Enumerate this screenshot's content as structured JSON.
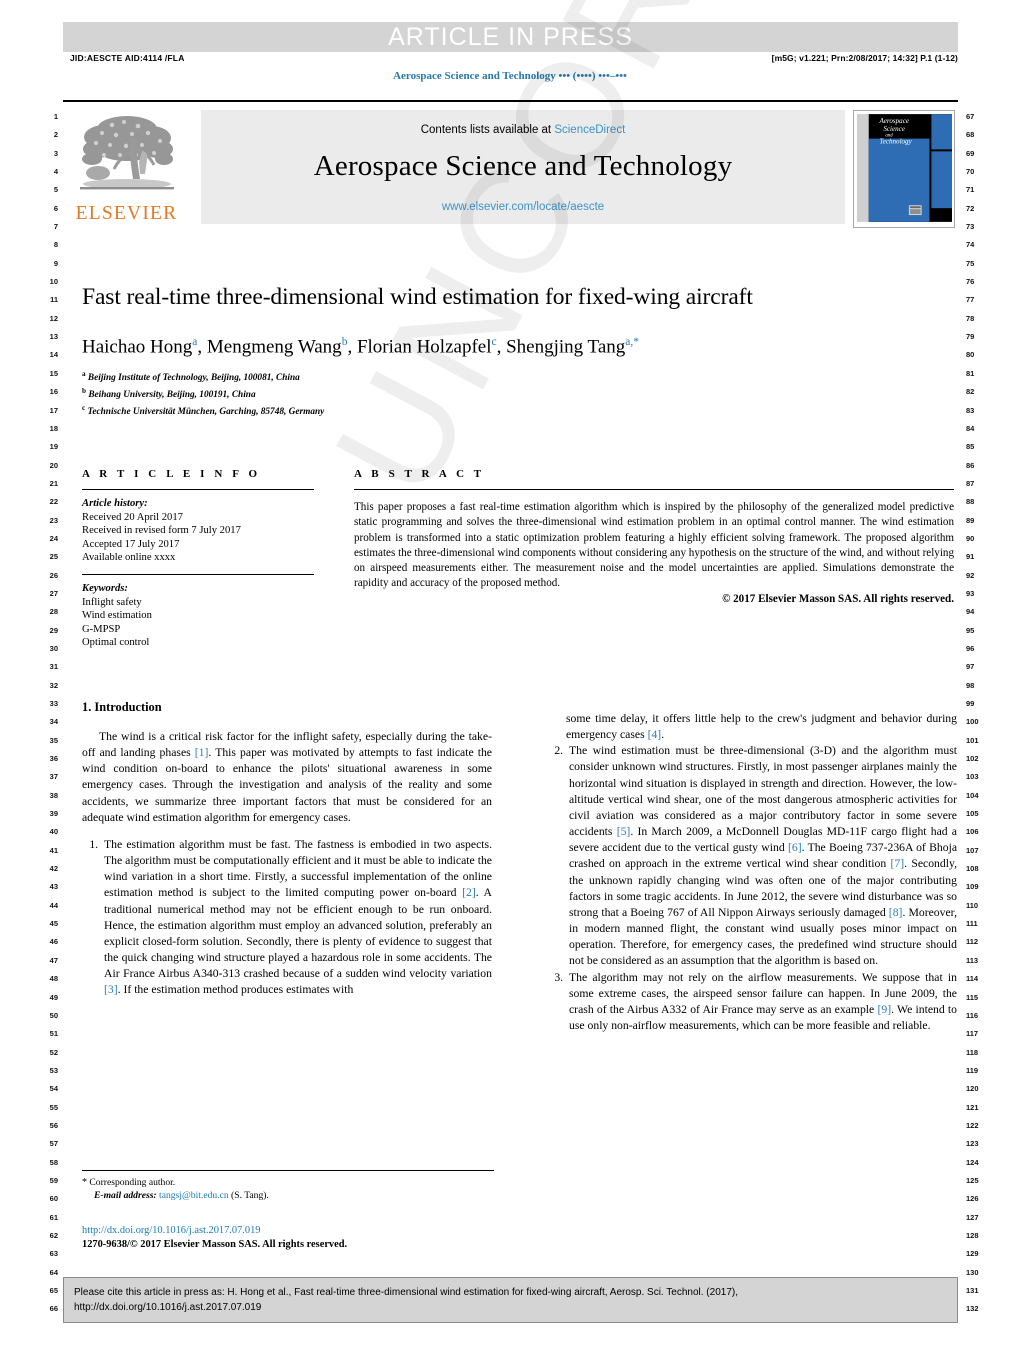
{
  "banner": {
    "press_text": "ARTICLE IN PRESS",
    "jid_line": "JID:AESCTE   AID:4114 /FLA",
    "stamp_line": "[m5G; v1.221; Prn:2/08/2017; 14:32] P.1 (1-12)",
    "running_head": "Aerospace Science and Technology ••• (••••) •••–•••"
  },
  "masthead": {
    "contents_prefix": "Contents lists available at",
    "contents_link": "ScienceDirect",
    "journal_title": "Aerospace Science and Technology",
    "journal_url": "www.elsevier.com/locate/aescte",
    "publisher_wordmark": "ELSEVIER",
    "publisher_logo_icon": "elsevier-tree-icon",
    "cover_icon": "journal-cover-thumbnail",
    "cover_title_lines": [
      "Aerospace",
      "Science",
      "and",
      "Technology"
    ]
  },
  "article": {
    "title": "Fast real-time three-dimensional wind estimation for fixed-wing aircraft",
    "authors": [
      {
        "name": "Haichao Hong",
        "sup": "a"
      },
      {
        "name": "Mengmeng Wang",
        "sup": "b"
      },
      {
        "name": "Florian Holzapfel",
        "sup": "c"
      },
      {
        "name": "Shengjing Tang",
        "sup": "a",
        "star": "*"
      }
    ],
    "affiliations": [
      {
        "label": "a",
        "text": "Beijing Institute of Technology, Beijing, 100081, China"
      },
      {
        "label": "b",
        "text": "Beihang University, Beijing, 100191, China"
      },
      {
        "label": "c",
        "text": "Technische Universität München, Garching, 85748, Germany"
      }
    ]
  },
  "info": {
    "heading": "A R T I C L E   I N F O",
    "history_label": "Article history:",
    "history": [
      "Received 20 April 2017",
      "Received in revised form 7 July 2017",
      "Accepted 17 July 2017",
      "Available online xxxx"
    ],
    "keywords_label": "Keywords:",
    "keywords": [
      "Inflight safety",
      "Wind estimation",
      "G-MPSP",
      "Optimal control"
    ]
  },
  "abstract": {
    "heading": "A B S T R A C T",
    "text": "This paper proposes a fast real-time estimation algorithm which is inspired by the philosophy of the generalized model predictive static programming and solves the three-dimensional wind estimation problem in an optimal control manner. The wind estimation problem is transformed into a static optimization problem featuring a highly efficient solving framework. The proposed algorithm estimates the three-dimensional wind components without considering any hypothesis on the structure of the wind, and without relying on airspeed measurements either. The measurement noise and the model uncertainties are applied. Simulations demonstrate the rapidity and accuracy of the proposed method.",
    "copyright": "© 2017 Elsevier Masson SAS. All rights reserved."
  },
  "body": {
    "section_title": "1. Introduction",
    "intro_paragraph": "The wind is a critical risk factor for the inflight safety, especially during the take-off and landing phases [1]. This paper was motivated by attempts to fast indicate the wind condition on-board to enhance the pilots' situational awareness in some emergency cases. Through the investigation and analysis of the reality and some accidents, we summarize three important factors that must be considered for an adequate wind estimation algorithm for emergency cases.",
    "list_items": [
      "The estimation algorithm must be fast. The fastness is embodied in two aspects. The algorithm must be computationally efficient and it must be able to indicate the wind variation in a short time. Firstly, a successful implementation of the online estimation method is subject to the limited computing power on-board [2]. A traditional numerical method may not be efficient enough to be run onboard. Hence, the estimation algorithm must employ an advanced solution, preferably an explicit closed-form solution. Secondly, there is plenty of evidence to suggest that the quick changing wind structure played a hazardous role in some accidents. The Air France Airbus A340-313 crashed because of a sudden wind velocity variation [3]. If the estimation method produces estimates with some time delay, it offers little help to the crew's judgment and behavior during emergency cases [4].",
      "The wind estimation must be three-dimensional (3-D) and the algorithm must consider unknown wind structures. Firstly, in most passenger airplanes mainly the horizontal wind situation is displayed in strength and direction. However, the low-altitude vertical wind shear, one of the most dangerous atmospheric activities for civil aviation was considered as a major contributory factor in some severe accidents [5]. In March 2009, a McDonnell Douglas MD-11F cargo flight had a severe accident due to the vertical gusty wind [6]. The Boeing 737-236A of Bhoja crashed on approach in the extreme vertical wind shear condition [7]. Secondly, the unknown rapidly changing wind was often one of the major contributing factors in some tragic accidents. In June 2012, the severe wind disturbance was so strong that a Boeing 767 of All Nippon Airways seriously damaged [8]. Moreover, in modern manned flight, the constant wind usually poses minor impact on operation. Therefore, for emergency cases, the predefined wind structure should not be considered as an assumption that the algorithm is based on.",
      "The algorithm may not rely on the airflow measurements. We suppose that in some extreme cases, the airspeed sensor failure can happen. In June 2009, the crash of the Airbus A332 of Air France may serve as an example [9]. We intend to use only non-airflow measurements, which can be more feasible and reliable."
    ]
  },
  "footnote": {
    "star": "*",
    "corresponding": "Corresponding author.",
    "email_label": "E-mail address:",
    "email": "tangsj@bit.edu.cn",
    "email_owner": "(S. Tang)."
  },
  "doi_block": {
    "doi_url": "http://dx.doi.org/10.1016/j.ast.2017.07.019",
    "issn_line": "1270-9638/© 2017 Elsevier Masson SAS. All rights reserved."
  },
  "cite_box": {
    "line1": "Please cite this article in press as: H. Hong et al., Fast real-time three-dimensional wind estimation for fixed-wing aircraft, Aerosp. Sci. Technol. (2017),",
    "line2": "http://dx.doi.org/10.1016/j.ast.2017.07.019"
  },
  "line_numbers": {
    "left_start": 1,
    "left_end": 66,
    "right_start": 67,
    "right_end": 132
  },
  "watermark": {
    "text": "UNCORRECTED PROOF"
  },
  "colors": {
    "link": "#3c93c8",
    "citation": "#2b7bb9",
    "elsevier_orange": "#E87722",
    "banner_grey": "#d4d4d4",
    "band_grey": "#ebebeb",
    "cover_blue": "#2e6db4"
  }
}
